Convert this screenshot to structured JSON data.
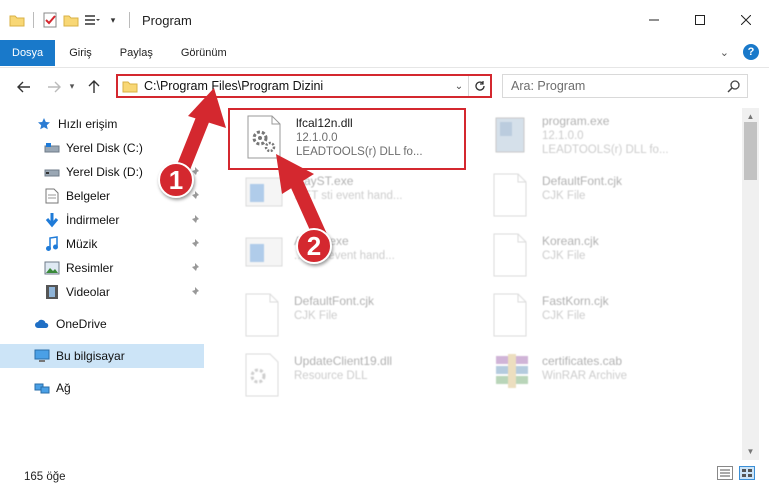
{
  "window": {
    "title": "Program"
  },
  "ribbon": {
    "tabs": [
      "Dosya",
      "Giriş",
      "Paylaş",
      "Görünüm"
    ],
    "help": "?"
  },
  "navigation": {
    "address_path": "C:\\Program Files\\Program Dizini",
    "search_placeholder": "Ara: Program"
  },
  "sidebar": {
    "items": [
      {
        "label": "Hızlı erişim",
        "icon": "star-icon",
        "pinned": false
      },
      {
        "label": "Yerel Disk (C:)",
        "icon": "drive-icon",
        "pinned": true
      },
      {
        "label": "Yerel Disk (D:)",
        "icon": "drive-icon",
        "pinned": true
      },
      {
        "label": "Belgeler",
        "icon": "documents-icon",
        "pinned": true
      },
      {
        "label": "İndirmeler",
        "icon": "download-icon",
        "pinned": true
      },
      {
        "label": "Müzik",
        "icon": "music-icon",
        "pinned": true
      },
      {
        "label": "Resimler",
        "icon": "pictures-icon",
        "pinned": true
      },
      {
        "label": "Videolar",
        "icon": "videos-icon",
        "pinned": true
      },
      {
        "label": "OneDrive",
        "icon": "cloud-icon",
        "pinned": false
      },
      {
        "label": "Bu bilgisayar",
        "icon": "computer-icon",
        "pinned": false,
        "selected": true
      },
      {
        "label": "Ağ",
        "icon": "network-icon",
        "pinned": false
      }
    ]
  },
  "files": [
    {
      "name": "lfcal12n.dll",
      "line1": "12.1.0.0",
      "line2": "LEADTOOLS(r) DLL fo...",
      "icon": "dll-gear-icon",
      "highlighted": true,
      "faded": false
    },
    {
      "name": "program.exe",
      "line1": "12.1.0.0",
      "line2": "LEADTOOLS(r) DLL fo...",
      "icon": "exe-icon",
      "highlighted": false,
      "faded": true
    },
    {
      "name": "...ayST.exe",
      "line1": "...ET sti event hand...",
      "line2": "",
      "icon": "window-icon",
      "highlighted": false,
      "faded": true
    },
    {
      "name": "DefaultFont.cjk",
      "line1": "CJK File",
      "line2": "",
      "icon": "blank-file-icon",
      "highlighted": false,
      "faded": true
    },
    {
      "name": "A...ST.exe",
      "line1": "...T sti event hand...",
      "line2": "",
      "icon": "window-icon",
      "highlighted": false,
      "faded": true
    },
    {
      "name": "Korean.cjk",
      "line1": "CJK File",
      "line2": "",
      "icon": "blank-file-icon",
      "highlighted": false,
      "faded": true
    },
    {
      "name": "DefaultFont.cjk",
      "line1": "CJK File",
      "line2": "",
      "icon": "blank-file-icon",
      "highlighted": false,
      "faded": true
    },
    {
      "name": "FastKorn.cjk",
      "line1": "CJK File",
      "line2": "",
      "icon": "blank-file-icon",
      "highlighted": false,
      "faded": true
    },
    {
      "name": "UpdateClient19.dll",
      "line1": "Resource DLL",
      "line2": "",
      "icon": "dll-gear-icon",
      "highlighted": false,
      "faded": true
    },
    {
      "name": "certificates.cab",
      "line1": "WinRAR Archive",
      "line2": "",
      "icon": "winrar-icon",
      "highlighted": false,
      "faded": true
    }
  ],
  "status": {
    "count": "165 öğe"
  },
  "callouts": [
    "1",
    "2"
  ],
  "colors": {
    "accent": "#1979ca",
    "highlight": "#d4282f",
    "selected_bg": "#cce4f7"
  }
}
